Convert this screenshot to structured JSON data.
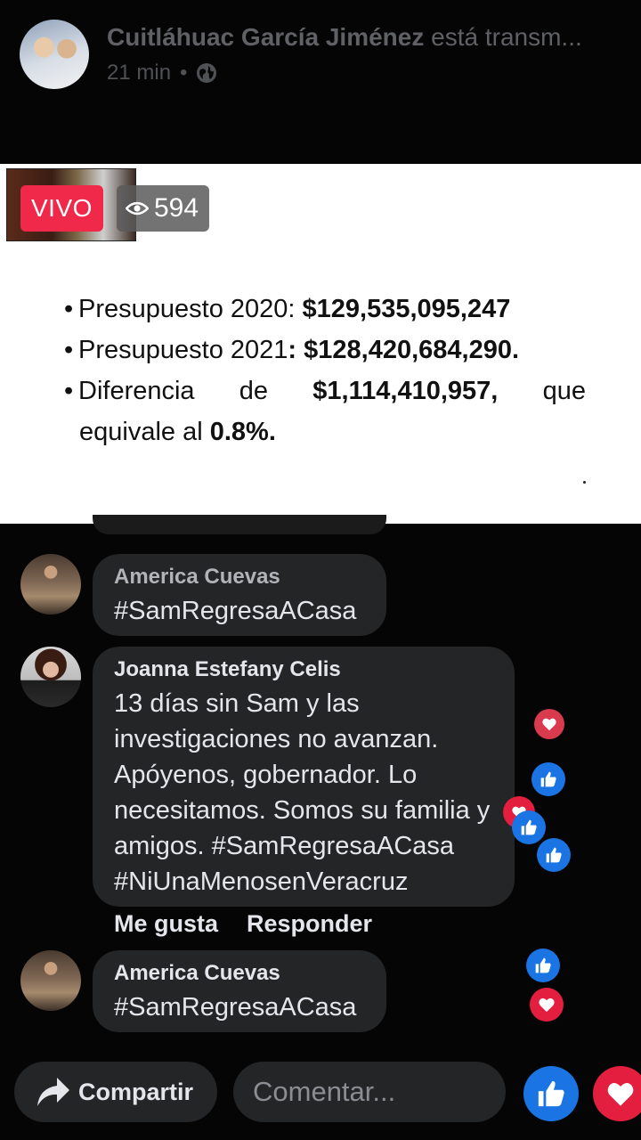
{
  "post": {
    "author": "Cuitláhuac García Jiménez",
    "action": " está transm...",
    "time": "21 min",
    "separator": "•"
  },
  "live": {
    "badge": "VIVO",
    "viewers": "594"
  },
  "slide": {
    "bullet": "•",
    "line1_label": "Presupuesto 2020: ",
    "line1_value": "$129,535,095,247",
    "line2_label": "Presupuesto 2021",
    "line2_value": ": $128,420,684,290.",
    "line3_word1": "Diferencia",
    "line3_word2": "de",
    "line3_value": "$1,114,410,957,",
    "line3_word3": "que",
    "line4_text": "equivale al ",
    "line4_value": "0.8%."
  },
  "comments": [
    {
      "name": "America Cuevas",
      "text": "#SamRegresaACasa"
    },
    {
      "name": "Joanna Estefany Celis",
      "text": "13 días sin Sam y las investigaciones no avanzan. Apóyenos, gobernador. Lo necesitamos. Somos su familia y amigos. #SamRegresaACasa #NiUnaMenosenVeracruz"
    },
    {
      "name": "America Cuevas",
      "text": "#SamRegresaACasa"
    }
  ],
  "comment_actions": {
    "like": "Me gusta",
    "reply": "Responder"
  },
  "bottom": {
    "share_label": "Compartir",
    "comment_placeholder": "Comentar..."
  },
  "colors": {
    "live_red": "#f02849",
    "like_blue": "#1b74e4",
    "love_red": "#e41e3f",
    "bubble": "#242526"
  },
  "icons": [
    "globe-icon",
    "eye-icon",
    "share-arrow-icon",
    "like-icon",
    "love-icon"
  ]
}
